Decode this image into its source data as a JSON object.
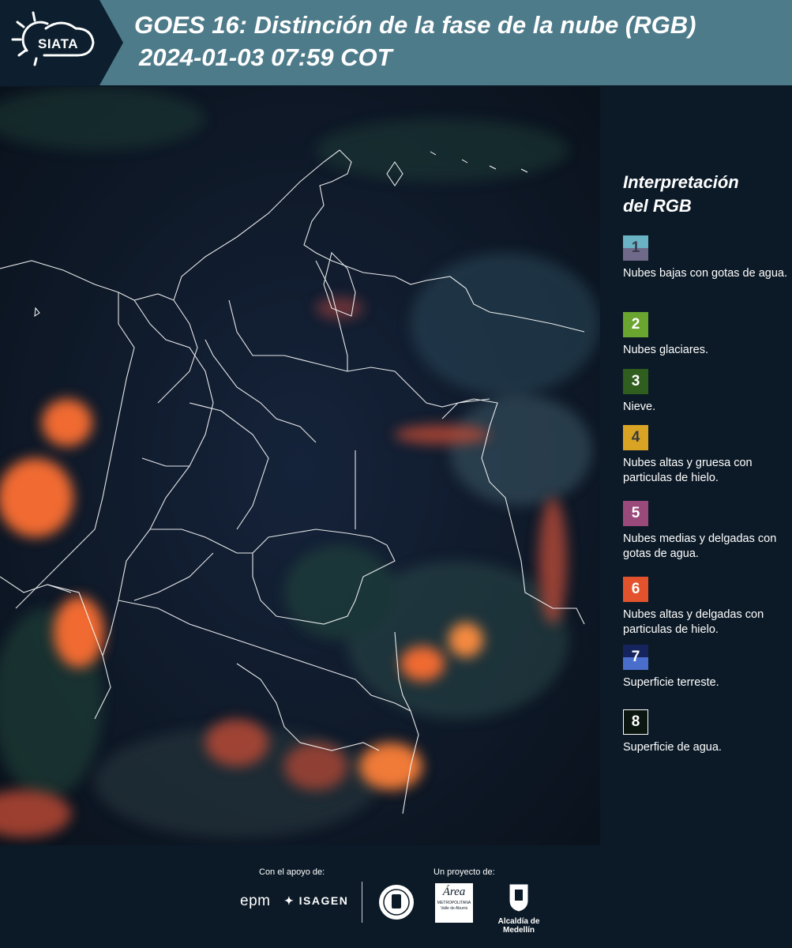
{
  "header": {
    "logo_text": "SIATA",
    "title_line1": "GOES 16: Distinción de la fase de la nube (RGB)",
    "title_line2": "2024-01-03 07:59 COT",
    "bg_color": "#4e7b8a"
  },
  "legend": {
    "title": "Interpretación\ndel RGB",
    "items": [
      {
        "num": "1",
        "text": "Nubes bajas con gotas de agua.",
        "color_top": "#6ab3c4",
        "color_bottom": "#6f6a8a"
      },
      {
        "num": "2",
        "text": "Nubes glaciares.",
        "color_top": "#6aa52f",
        "color_bottom": "#6aa52f"
      },
      {
        "num": "3",
        "text": "Nieve.",
        "color_top": "#2f5e1f",
        "color_bottom": "#2f5e1f"
      },
      {
        "num": "4",
        "text": "Nubes altas y gruesa con particulas de hielo.",
        "color_top": "#d9a424",
        "color_bottom": "#d9a424"
      },
      {
        "num": "5",
        "text": "Nubes medias y delgadas con gotas de agua.",
        "color_top": "#9a4a7a",
        "color_bottom": "#9a4a7a"
      },
      {
        "num": "6",
        "text": "Nubes altas y delgadas con particulas de hielo.",
        "color_top": "#e2532d",
        "color_bottom": "#e2532d"
      },
      {
        "num": "7",
        "text": "Superficie terreste.",
        "color_top": "#16245e",
        "color_bottom": "#4a6ecb"
      },
      {
        "num": "8",
        "text": "Superficie de agua.",
        "color_top": "#0a160f",
        "color_bottom": "#0a160f"
      }
    ]
  },
  "footer": {
    "support_label": "Con el apoyo de:",
    "project_label": "Un proyecto de:",
    "partners": {
      "epm": "epm",
      "isagen": "ISAGEN",
      "area_metro": "Área",
      "area_metro_sub": "METROPOLITANA",
      "area_metro_sub2": "Valle de Aburrá",
      "alcaldia": "Alcaldía de Medellín"
    }
  }
}
